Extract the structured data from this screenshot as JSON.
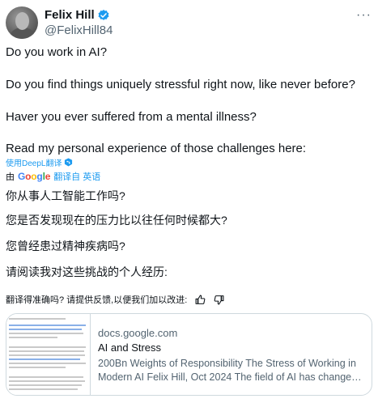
{
  "author": {
    "display_name": "Felix Hill",
    "handle": "@FelixHill84",
    "verified_icon": "verified-badge-icon",
    "more_label": "···"
  },
  "tweet": {
    "paragraphs": [
      "Do you work in AI?",
      "Do you find things uniquely stressful right now, like never before?",
      "Haver you ever suffered from a mental illness?",
      "Read my personal experience of those challenges here:"
    ]
  },
  "translation": {
    "deepl_link": "使用DeepL翻译",
    "by_prefix": "由",
    "google": [
      "G",
      "o",
      "o",
      "g",
      "l",
      "e"
    ],
    "translated_from": "翻译自 英语",
    "paragraphs": [
      "你从事人工智能工作吗?",
      "您是否发现现在的压力比以往任何时候都大?",
      "您曾经患过精神疾病吗?",
      "请阅读我对这些挑战的个人经历:"
    ],
    "feedback": "翻译得准确吗? 请提供反馈,以便我们加以改进:"
  },
  "link_card": {
    "domain": "docs.google.com",
    "title": "AI and Stress",
    "description_lines": [
      "200Bn Weights of Responsibility The Stress of Working in",
      "Modern AI Felix Hill, Oct 2024 The field of AI has changed ..."
    ]
  },
  "colors": {
    "link_blue": "#1d9bf0",
    "text": "#0f1419",
    "muted": "#536471",
    "border": "#cfd9de"
  }
}
